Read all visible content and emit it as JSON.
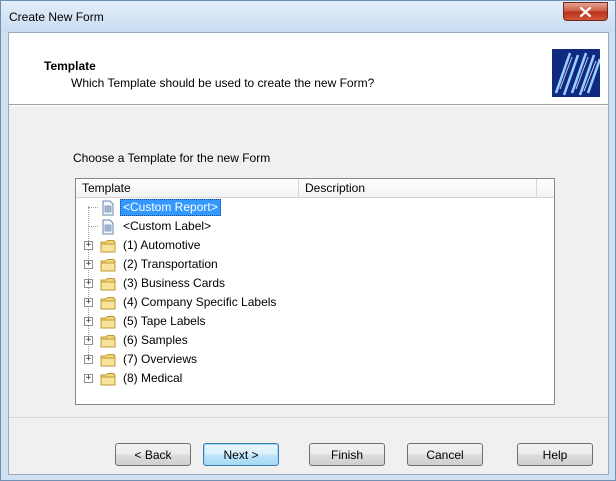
{
  "window": {
    "title": "Create New Form"
  },
  "header": {
    "title": "Template",
    "subtitle": "Which Template should be used to create the new Form?"
  },
  "prompt": "Choose a Template for the new Form",
  "columns": {
    "template": "Template",
    "description": "Description"
  },
  "tree": {
    "items": [
      {
        "label": "<Custom Report>",
        "type": "document",
        "selected": true
      },
      {
        "label": "<Custom Label>",
        "type": "document",
        "selected": false
      },
      {
        "label": "(1) Automotive",
        "type": "folder"
      },
      {
        "label": "(2) Transportation",
        "type": "folder"
      },
      {
        "label": "(3) Business Cards",
        "type": "folder"
      },
      {
        "label": "(4) Company Specific Labels",
        "type": "folder"
      },
      {
        "label": "(5) Tape Labels",
        "type": "folder"
      },
      {
        "label": "(6) Samples",
        "type": "folder"
      },
      {
        "label": "(7) Overviews",
        "type": "folder"
      },
      {
        "label": "(8) Medical",
        "type": "folder"
      }
    ]
  },
  "buttons": {
    "back": "< Back",
    "next": "Next >",
    "finish": "Finish",
    "cancel": "Cancel",
    "help": "Help"
  },
  "colors": {
    "selection": "#3399ff",
    "close": "#c95b43",
    "folder": "#f3d57a"
  }
}
